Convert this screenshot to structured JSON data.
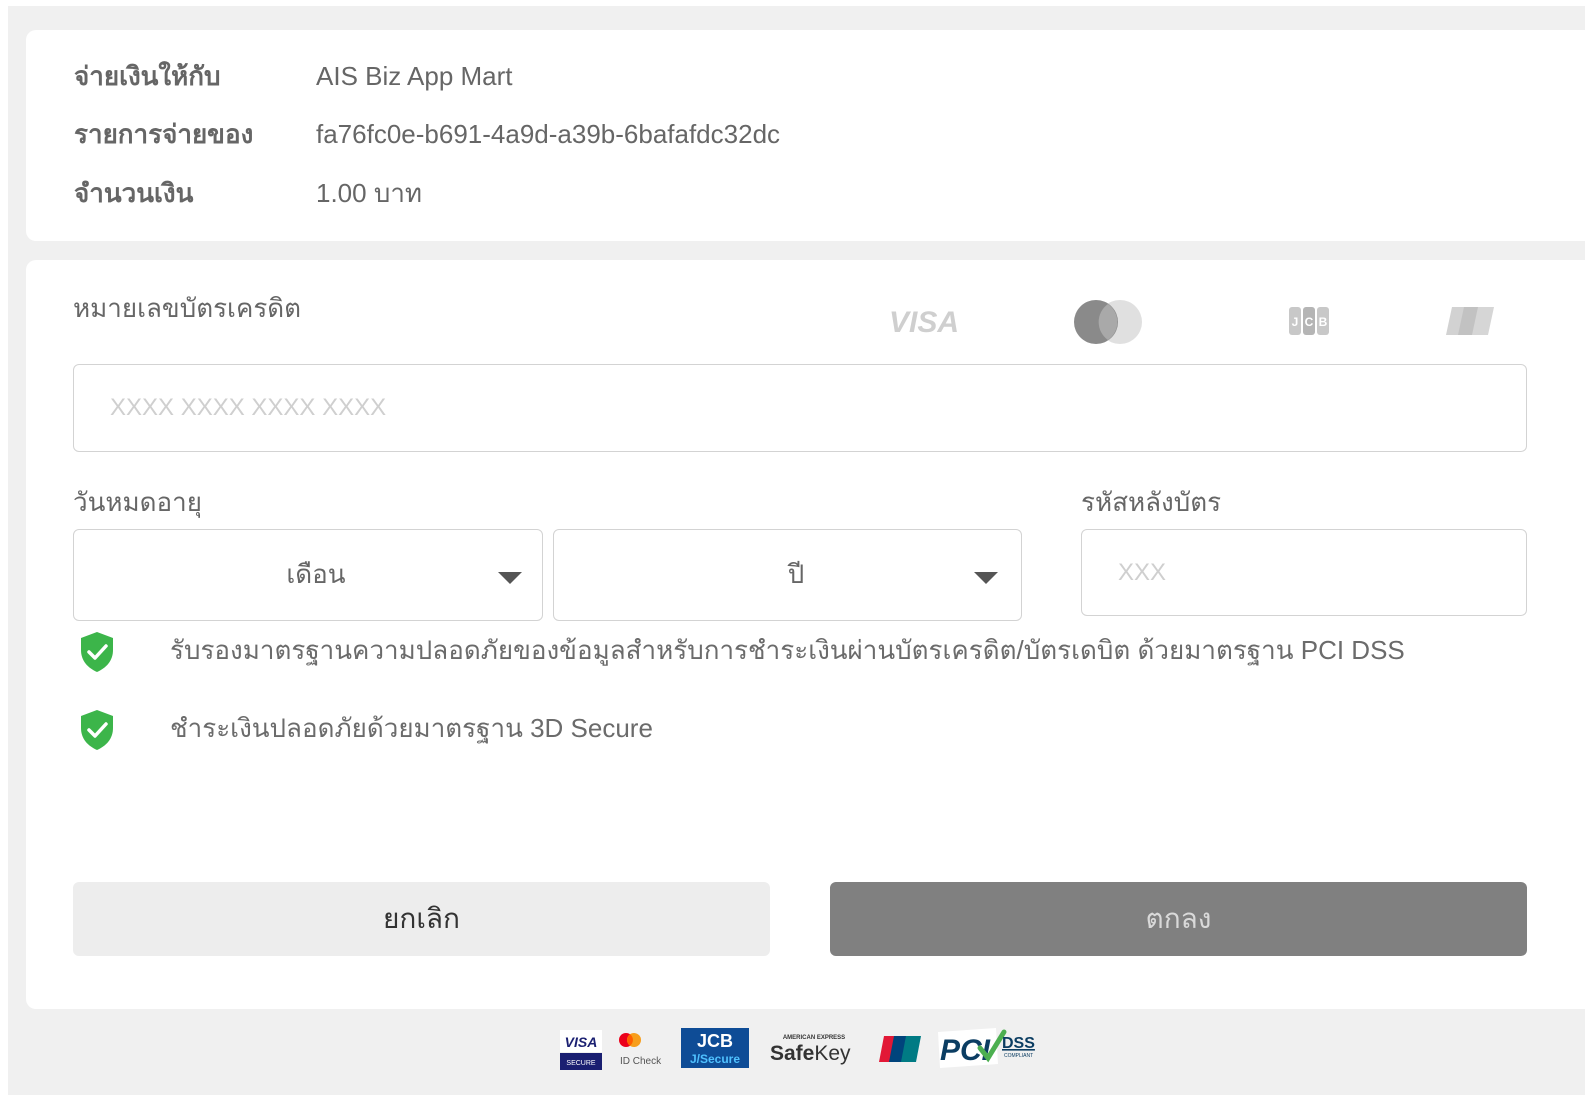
{
  "summary": {
    "pay_to_label": "จ่ายเงินให้กับ",
    "pay_to_value": "AIS Biz App Mart",
    "order_label": "รายการจ่ายของ",
    "order_value": "fa76fc0e-b691-4a9d-a39b-6bafafdc32dc",
    "amount_label": "จำนวนเงิน",
    "amount_value": "1.00 บาท"
  },
  "card_form": {
    "card_number_label": "หมายเลขบัตรเครดิต",
    "card_number_placeholder": "XXXX XXXX XXXX XXXX",
    "card_number_value": "",
    "expiry_label": "วันหมดอายุ",
    "month_selected": "เดือน",
    "year_selected": "ปี",
    "cvv_label": "รหัสหลังบัตร",
    "cvv_placeholder": "XXX",
    "cvv_value": "",
    "brands": [
      "VISA",
      "Mastercard",
      "JCB",
      "UnionPay"
    ]
  },
  "security_notes": [
    "รับรองมาตรฐานความปลอดภัยของข้อมูลสำหรับการชำระเงินผ่านบัตรเครดิต/บัตรเดบิต ด้วยมาตรฐาน PCI DSS",
    "ชำระเงินปลอดภัยด้วยมาตรฐาน 3D Secure"
  ],
  "buttons": {
    "cancel_label": "ยกเลิก",
    "ok_label": "ตกลง"
  },
  "footer": {
    "visa_secure": {
      "top": "VISA",
      "bottom": "SECURE"
    },
    "mastercard_id_check": "ID Check",
    "jcb_secure": {
      "top": "JCB",
      "bottom": "J/Secure"
    },
    "amex_safekey": {
      "top": "AMERICAN EXPRESS",
      "bottom_a": "Safe",
      "bottom_b": "Key"
    },
    "pci_dss": {
      "main": "PCI",
      "side": "DSS",
      "small": "COMPLIANT"
    }
  },
  "colors": {
    "page_bg": "#f0f0f0",
    "card_bg": "#ffffff",
    "shield_green": "#3cb54a",
    "ok_button": "#808080",
    "cancel_button": "#ededed"
  },
  "icons": [
    "shield-check-icon",
    "chevron-down-icon"
  ]
}
